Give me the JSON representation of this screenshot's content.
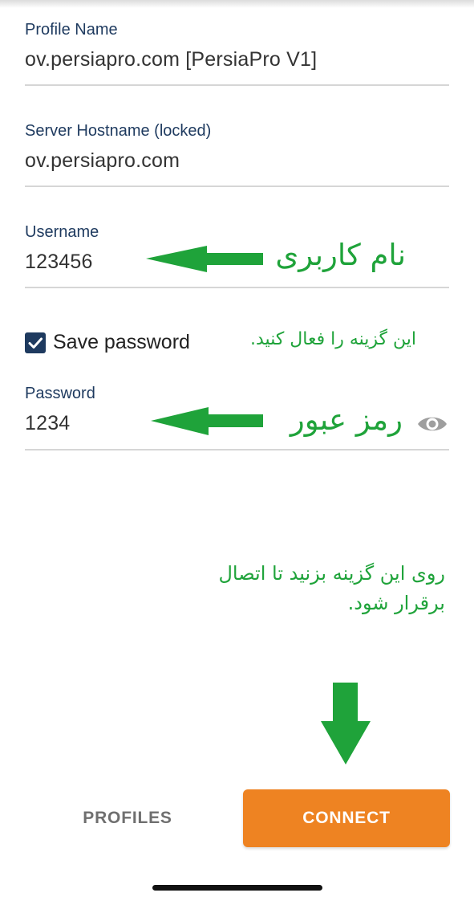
{
  "profile": {
    "name_label": "Profile Name",
    "name_value": "ov.persiapro.com [PersiaPro V1]"
  },
  "server": {
    "label": "Server Hostname (locked)",
    "value": "ov.persiapro.com"
  },
  "username": {
    "label": "Username",
    "value": "123456"
  },
  "save_password": {
    "label": "Save password",
    "checked": true
  },
  "password": {
    "label": "Password",
    "value": "1234"
  },
  "annotations": {
    "username_note": "نام کاربری",
    "save_password_note": "این گزینه را فعال کنید.",
    "password_note": "رمز عبور",
    "connect_note_line1": "روی این گزینه بزنید تا اتصال",
    "connect_note_line2": "برقرار شود."
  },
  "actions": {
    "profiles_label": "PROFILES",
    "connect_label": "CONNECT"
  },
  "colors": {
    "label_navy": "#1e3a5f",
    "annotation_green": "#1fa33a",
    "connect_orange": "#ee8322"
  },
  "icons": {
    "visibility": "eye-icon",
    "checkbox": "check-icon"
  }
}
